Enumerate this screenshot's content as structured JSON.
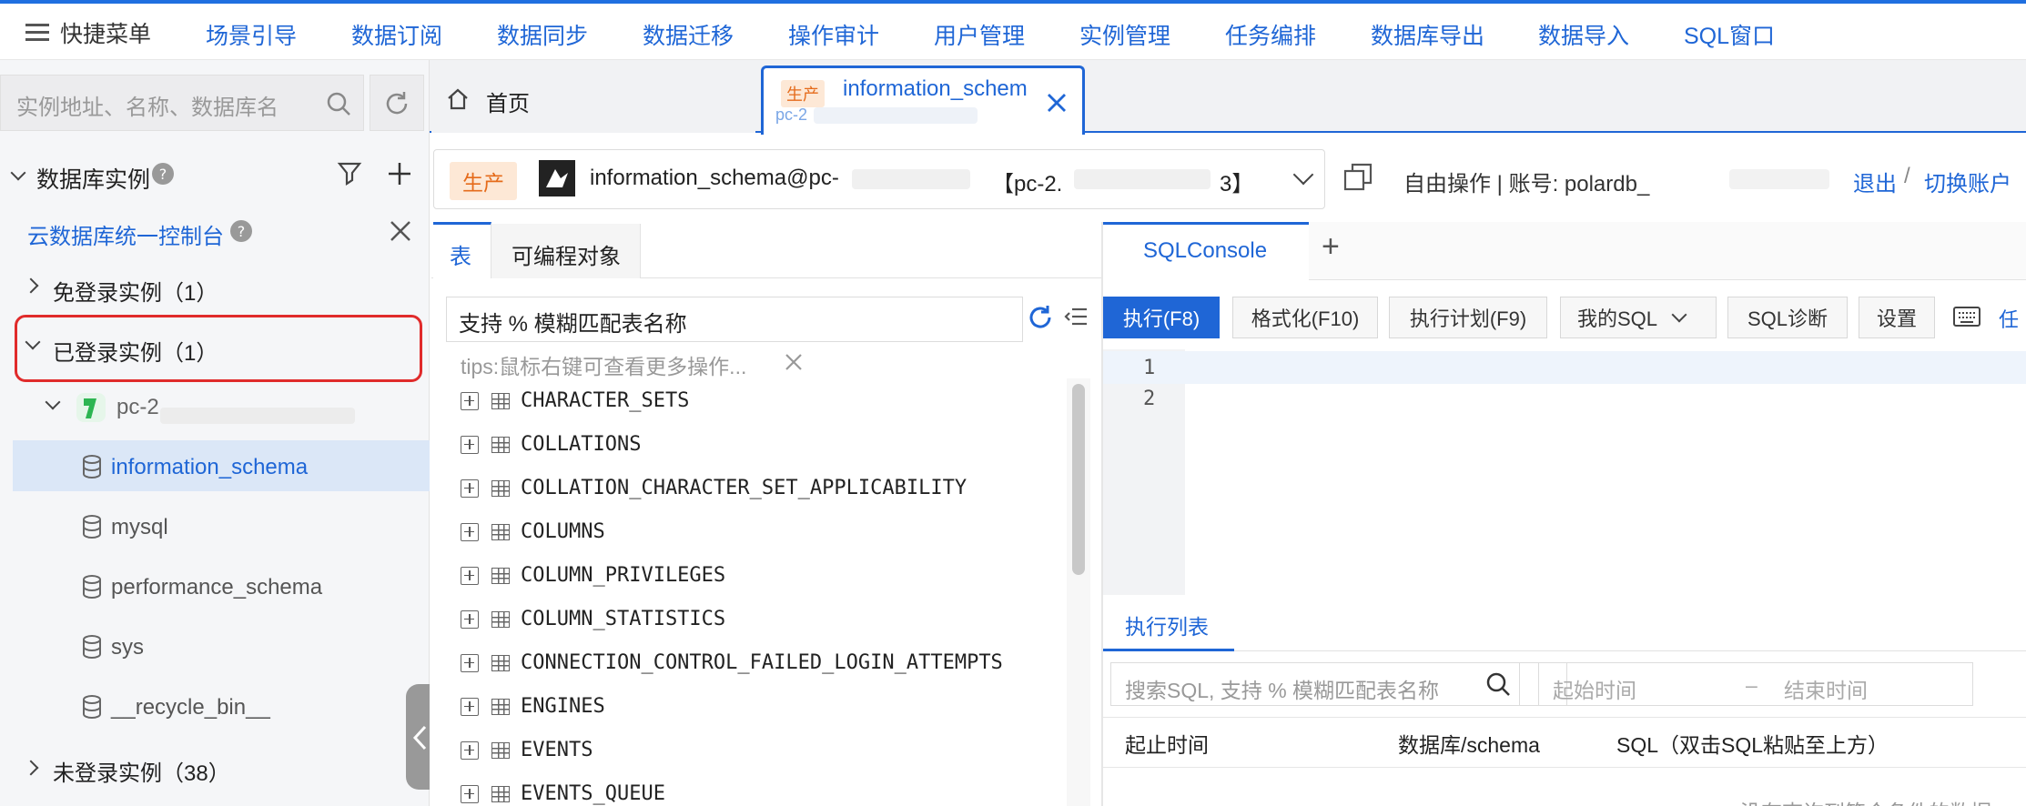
{
  "menu": {
    "quick_menu": "快捷菜单",
    "items": [
      "场景引导",
      "数据订阅",
      "数据同步",
      "数据迁移",
      "操作审计",
      "用户管理",
      "实例管理",
      "任务编排",
      "数据库导出",
      "数据导入",
      "SQL窗口"
    ]
  },
  "sidebar": {
    "search_placeholder": "实例地址、名称、数据库名",
    "section_title": "数据库实例",
    "console_link": "云数据库统一控制台",
    "groups": {
      "free_login": "免登录实例（1）",
      "logged_in": "已登录实例（1）",
      "not_logged": "未登录实例（38）"
    },
    "instance_name": "pc-2",
    "databases": [
      "information_schema",
      "mysql",
      "performance_schema",
      "sys",
      "__recycle_bin__"
    ]
  },
  "tabs": {
    "home": "首页",
    "active_badge": "生产",
    "active_title": "information_schem",
    "active_sub": "pc-2"
  },
  "connection": {
    "badge": "生产",
    "db_prefix": "information_schema@pc-",
    "db_bracket_start": "【pc-2.",
    "db_bracket_end": "3】",
    "mode": "自由操作 | 账号: polardb_",
    "logout": "退出",
    "sep": "/",
    "switch": "切换账户"
  },
  "object_panel": {
    "tabs": [
      "表",
      "可编程对象"
    ],
    "search_placeholder": "支持 % 模糊匹配表名称",
    "tips": "tips:鼠标右键可查看更多操作...",
    "tables": [
      "CHARACTER_SETS",
      "COLLATIONS",
      "COLLATION_CHARACTER_SET_APPLICABILITY",
      "COLUMNS",
      "COLUMN_PRIVILEGES",
      "COLUMN_STATISTICS",
      "CONNECTION_CONTROL_FAILED_LOGIN_ATTEMPTS",
      "ENGINES",
      "EVENTS",
      "EVENTS_QUEUE"
    ]
  },
  "sql_panel": {
    "tab": "SQLConsole",
    "add": "+",
    "buttons": {
      "run": "执行(F8)",
      "format": "格式化(F10)",
      "plan": "执行计划(F9)",
      "my_sql": "我的SQL",
      "diagnose": "SQL诊断",
      "settings": "设置",
      "task": "任"
    },
    "line_numbers": [
      "1",
      "2"
    ]
  },
  "exec_list": {
    "tab": "执行列表",
    "search_placeholder": "搜索SQL, 支持 % 模糊匹配表名称",
    "start_time": "起始时间",
    "dash": "–",
    "end_time": "结束时间",
    "columns": [
      "起止时间",
      "数据库/schema",
      "SQL（双击SQL粘贴至上方）"
    ],
    "empty_partial": "没有查询到符合条件的数据"
  }
}
